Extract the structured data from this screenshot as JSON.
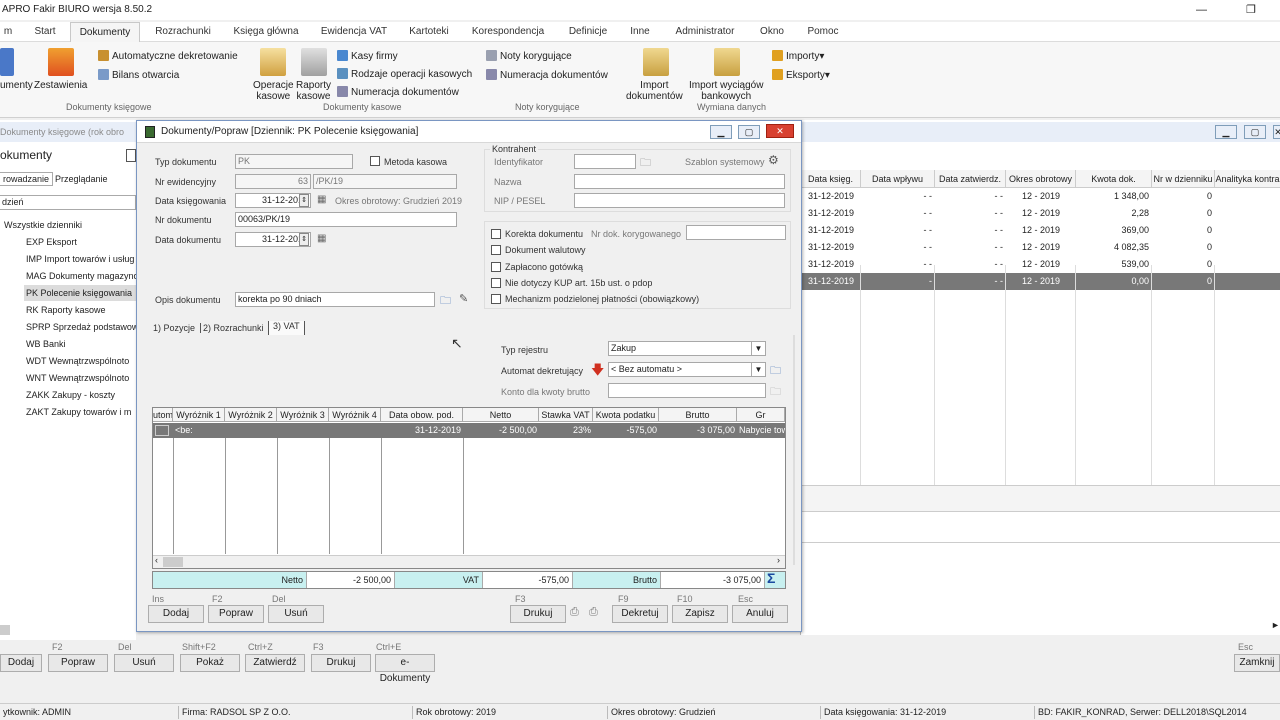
{
  "app_title": "APRO Fakir BIURO wersja 8.50.2",
  "menu": [
    "m",
    "Start",
    "Dokumenty",
    "Rozrachunki",
    "Księga główna",
    "Ewidencja VAT",
    "Kartoteki",
    "Korespondencja",
    "Definicje",
    "Inne",
    "Administrator",
    "Okno",
    "Pomoc"
  ],
  "ribbon": {
    "dokumenty_label": "umenty",
    "zestawienia_label": "Zestawienia",
    "auto_dekret": "Automatyczne dekretowanie",
    "bilans": "Bilans otwarcia",
    "group_dok": "Dokumenty księgowe",
    "operacje_kasowe": "Operacje\nkasowe",
    "raporty_kasowe": "Raporty\nkasowe",
    "kasy_firmy": "Kasy firmy",
    "rodzaje_oper": "Rodzaje operacji kasowych",
    "numeracja_dok": "Numeracja dokumentów",
    "group_kas": "Dokumenty kasowe",
    "noty_kor": "Noty korygujące",
    "numeracja_dok2": "Numeracja dokumentów",
    "group_noty": "Noty korygujące",
    "import_dok": "Import\ndokumentów",
    "import_wyc": "Import wyciągów\nbankowych",
    "importy": "Importy",
    "eksporty": "Eksporty",
    "group_wym": "Wymiana danych"
  },
  "left": {
    "window_title": "Dokumenty księgowe (rok obro",
    "heading": "okumenty",
    "tab1": "rowadzanie",
    "tab2": "Przeglądanie",
    "filter": "dzień",
    "items": [
      "Wszystkie dzienniki",
      "EXP Eksport",
      "IMP Import towarów i usług",
      "MAG Dokumenty magazyno",
      "PK Polecenie księgowania",
      "RK Raporty kasowe",
      "SPRP Sprzedaż podstawow",
      "WB Banki",
      "WDT Wewnątrzwspólnoto",
      "WNT Wewnątrzwspólnoto",
      "ZAKK Zakupy - koszty",
      "ZAKT Zakupy towarów i m"
    ]
  },
  "right": {
    "headers": [
      "Data księg.",
      "Data wpływu",
      "Data zatwierdz.",
      "Okres obrotowy",
      "Kwota dok.",
      "Nr w dzienniku",
      "Analityka kontra"
    ],
    "rows": [
      [
        "31-12-2019",
        "- -",
        "- -",
        "12 - 2019",
        "1 348,00",
        "0"
      ],
      [
        "31-12-2019",
        "- -",
        "- -",
        "12 - 2019",
        "2,28",
        "0"
      ],
      [
        "31-12-2019",
        "- -",
        "- -",
        "12 - 2019",
        "369,00",
        "0"
      ],
      [
        "31-12-2019",
        "- -",
        "- -",
        "12 - 2019",
        "4 082,35",
        "0"
      ],
      [
        "31-12-2019",
        "- -",
        "- -",
        "12 - 2019",
        "539,00",
        "0"
      ],
      [
        "31-12-2019",
        "-",
        "- -",
        "12 - 2019",
        "0,00",
        "0"
      ]
    ]
  },
  "dialog": {
    "title": "Dokumenty/Popraw [Dziennik: PK  Polecenie księgowania]",
    "typ_dok_label": "Typ dokumentu",
    "typ_dok": "PK",
    "metoda_kasowa": "Metoda kasowa",
    "nr_ewid_label": "Nr ewidencyjny",
    "nr_ewid": "63",
    "nr_ewid_suffix": "/PK/19",
    "data_ks_label": "Data księgowania",
    "data_ks": "31-12-2019",
    "okres_info": "Okres obrotowy: Grudzień 2019",
    "nr_dok_label": "Nr dokumentu",
    "nr_dok": "00063/PK/19",
    "data_dok_label": "Data dokumentu",
    "data_dok": "31-12-2019",
    "opis_label": "Opis dokumentu",
    "opis": "korekta po 90 dniach",
    "kontrahent": "Kontrahent",
    "identyfikator": "Identyfikator",
    "szablon": "Szablon systemowy",
    "nazwa": "Nazwa",
    "nip": "NIP / PESEL",
    "korekta": "Korekta dokumentu",
    "nr_dok_kor": "Nr dok. korygowanego",
    "walutowy": "Dokument walutowy",
    "zaplacono": "Zapłacono gotówką",
    "nie_dotyczy": "Nie dotyczy KUP art. 15b ust. o pdop",
    "mechanizm": "Mechanizm podzielonej płatności (obowiązkowy)",
    "tabs": [
      "1) Pozycje",
      "2) Rozrachunki",
      "3) VAT"
    ],
    "typ_rej_label": "Typ rejestru",
    "typ_rej": "Zakup",
    "automat_label": "Automat dekretujący",
    "automat": "< Bez automatu >",
    "konto_label": "Konto dla kwoty brutto",
    "table_headers": [
      "utom",
      "Wyróżnik 1",
      "Wyróżnik 2",
      "Wyróżnik 3",
      "Wyróżnik 4",
      "Data obow. pod.",
      "Netto",
      "Stawka VAT",
      "Kwota podatku",
      "Brutto",
      "Gr"
    ],
    "row": [
      "<be:",
      "",
      "",
      "",
      "",
      "31-12-2019",
      "-2 500,00",
      "23%",
      "-575,00",
      "-3 075,00",
      "Nabycie tow"
    ],
    "sum": {
      "netto_label": "Netto",
      "netto": "-2 500,00",
      "vat_label": "VAT",
      "vat": "-575,00",
      "brutto_label": "Brutto",
      "brutto": "-3 075,00"
    },
    "hotkeys": [
      "Ins",
      "F2",
      "Del",
      "F3",
      "F9",
      "F10",
      "Esc"
    ],
    "buttons": [
      "Dodaj",
      "Popraw",
      "Usuń",
      "Drukuj",
      "Dekretuj",
      "Zapisz",
      "Anuluj"
    ]
  },
  "bottom": {
    "hotkeys": [
      "F2",
      "Del",
      "Shift+F2",
      "Ctrl+Z",
      "F3",
      "Ctrl+E",
      "Esc"
    ],
    "buttons": [
      "Dodaj",
      "Popraw",
      "Usuń",
      "Pokaż",
      "Zatwierdź",
      "Drukuj",
      "e-Dokumenty",
      "Zamknij"
    ]
  },
  "status": [
    "ytkownik: ADMIN",
    "Firma: RADSOL SP Z O.O.",
    "Rok obrotowy: 2019",
    "Okres obrotowy: Grudzień",
    "Data księgowania: 31-12-2019",
    "BD: FAKIR_KONRAD, Serwer: DELL2018\\SQL2014"
  ]
}
